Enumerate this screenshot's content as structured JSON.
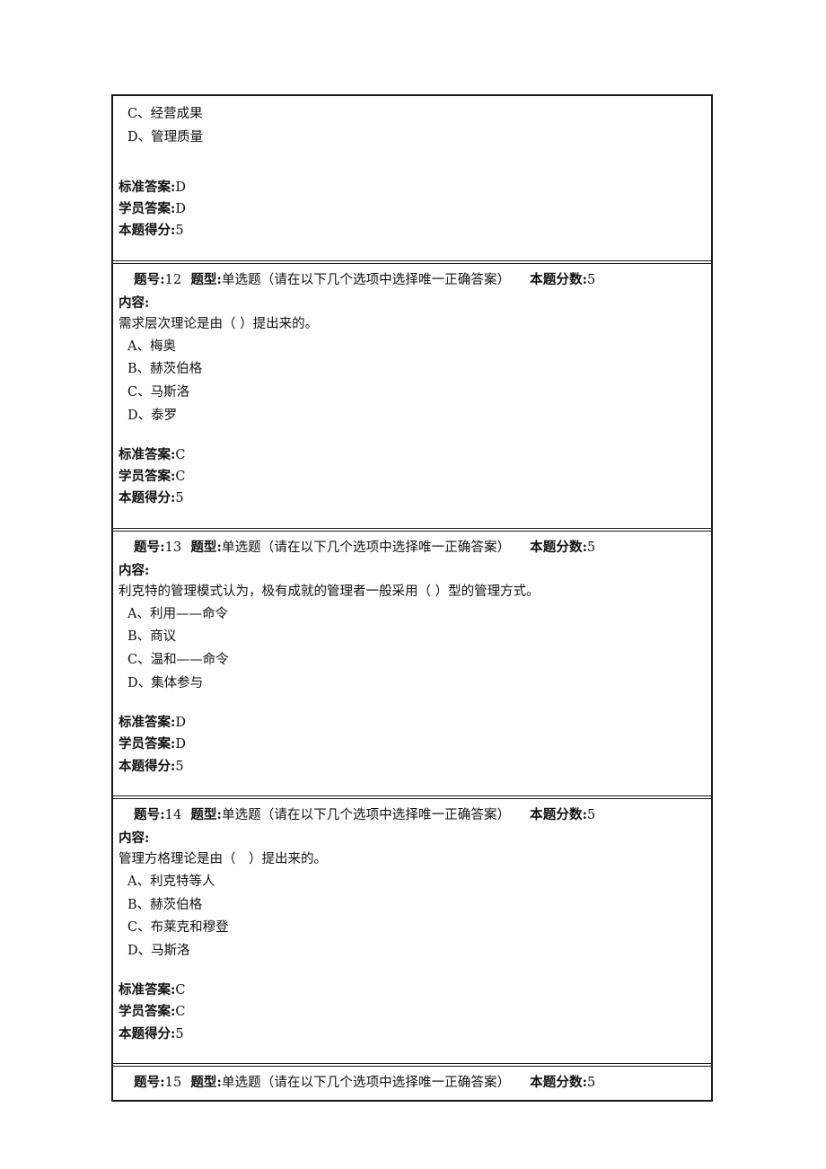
{
  "document": {
    "type": "exam-answer-sheet",
    "labels": {
      "question_number": "题号:",
      "question_type": "题型:",
      "question_score": "本题分数:",
      "content": "内容:",
      "standard_answer": "标准答案:",
      "student_answer": "学员答案:",
      "score_earned": "本题得分:"
    },
    "type_text": "单选题（请在以下几个选项中选择唯一正确答案）"
  },
  "blocks": [
    {
      "partial": "top",
      "options": [
        "C、经营成果",
        "D、管理质量"
      ],
      "standard_answer": "D",
      "student_answer": "D",
      "score_earned": "5"
    },
    {
      "number": "12",
      "type_text": "单选题（请在以下几个选项中选择唯一正确答案）",
      "score": "5",
      "content": "需求层次理论是由（ ）提出来的。",
      "options": [
        "A、梅奥",
        "B、赫茨伯格",
        "C、马斯洛",
        "D、泰罗"
      ],
      "standard_answer": "C",
      "student_answer": "C",
      "score_earned": "5"
    },
    {
      "number": "13",
      "type_text": "单选题（请在以下几个选项中选择唯一正确答案）",
      "score": "5",
      "content": "利克特的管理模式认为，极有成就的管理者一般采用（ ）型的管理方式。",
      "options": [
        "A、利用——命令",
        "B、商议",
        "C、温和——命令",
        "D、集体参与"
      ],
      "standard_answer": "D",
      "student_answer": "D",
      "score_earned": "5"
    },
    {
      "number": "14",
      "type_text": "单选题（请在以下几个选项中选择唯一正确答案）",
      "score": "5",
      "content": "管理方格理论是由（　）提出来的。",
      "options": [
        "A、利克特等人",
        "B、赫茨伯格",
        "C、布莱克和穆登",
        "D、马斯洛"
      ],
      "standard_answer": "C",
      "student_answer": "C",
      "score_earned": "5"
    },
    {
      "partial": "bottom",
      "number": "15",
      "type_text": "单选题（请在以下几个选项中选择唯一正确答案）",
      "score": "5"
    }
  ]
}
